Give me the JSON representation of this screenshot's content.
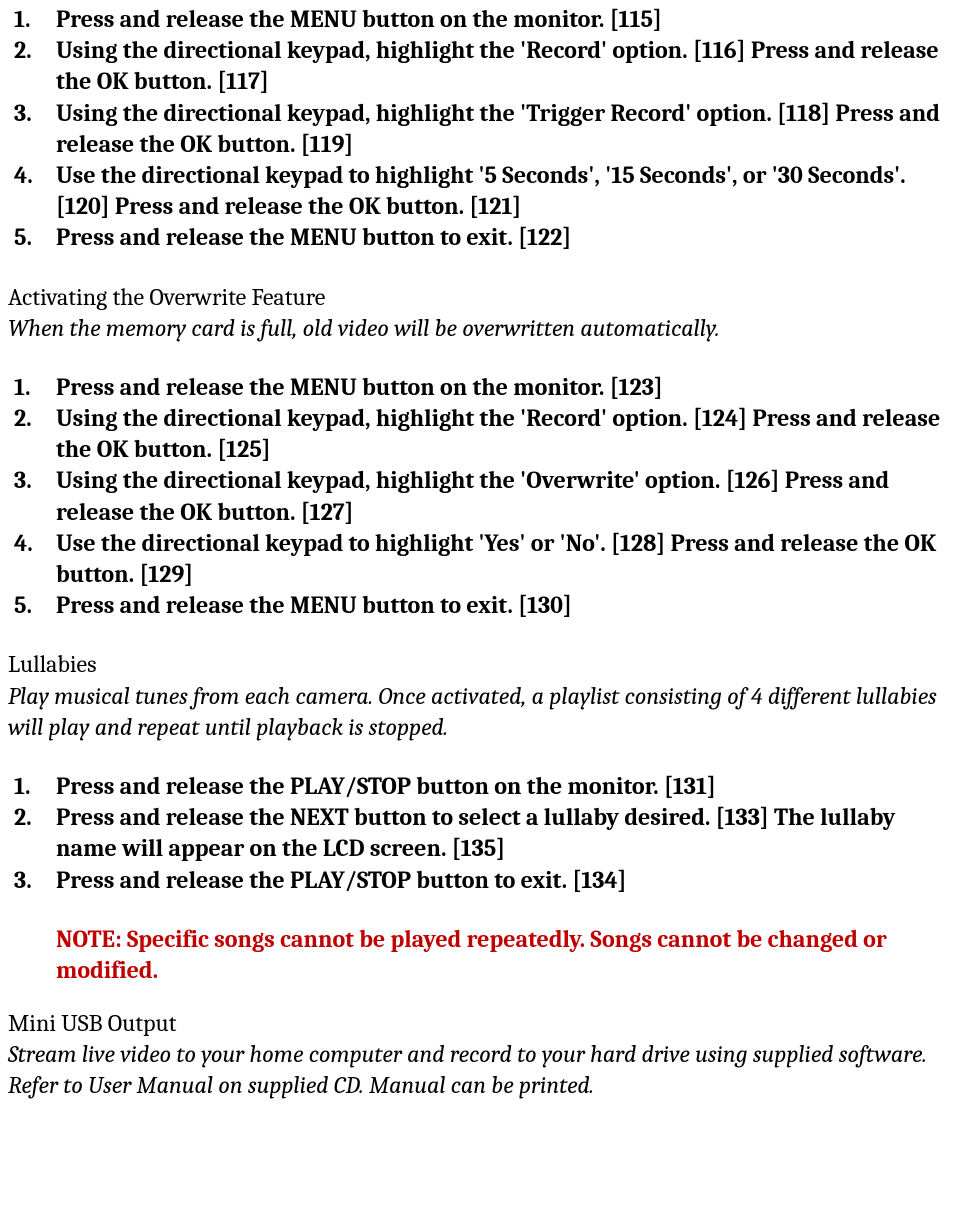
{
  "trigger_steps": [
    "Press and release the MENU button on the monitor. [115]",
    "Using the directional keypad, highlight the 'Record' option. [116] Press and release the OK button. [117]",
    "Using the directional keypad, highlight the 'Trigger Record' option. [118] Press and release the OK button. [119]",
    "Use the directional keypad to highlight '5 Seconds', '15 Seconds', or '30 Seconds'. [120] Press and release the OK button. [121]",
    "Press and release the MENU button to exit. [122]"
  ],
  "overwrite": {
    "title": "Activating the Overwrite Feature",
    "desc": "When the memory card is full, old video will be overwritten automatically.",
    "steps": [
      "Press and release the MENU button on the monitor. [123]",
      "Using the directional keypad, highlight the 'Record' option. [124] Press and release the OK button. [125]",
      "Using the directional keypad, highlight the 'Overwrite' option. [126] Press and release the OK button. [127]",
      "Use the directional keypad to highlight 'Yes' or 'No'. [128] Press and release the OK button. [129]",
      "Press and release the MENU button to exit. [130]"
    ]
  },
  "lullabies": {
    "title": "Lullabies",
    "desc": "Play musical tunes from each camera. Once activated, a playlist consisting of 4 different lullabies will play and repeat until playback is stopped.",
    "steps": [
      "Press and release the PLAY/STOP button on the monitor. [131]",
      "Press and release the NEXT button to select a lullaby desired. [133] The lullaby name will appear on the LCD screen. [135]",
      "Press and release the PLAY/STOP button to exit. [134]"
    ],
    "note": "NOTE: Specific songs cannot be played repeatedly. Songs cannot be changed or modified."
  },
  "usb": {
    "title": "Mini USB Output",
    "desc": "Stream live video to your home computer and record to your hard drive using supplied software. Refer to User Manual on supplied CD. Manual can be printed."
  }
}
